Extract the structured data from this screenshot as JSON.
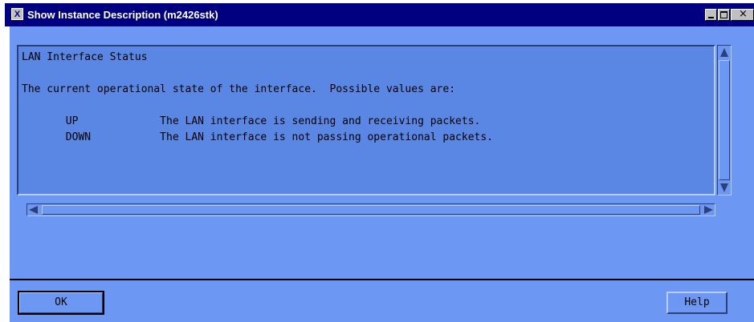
{
  "window": {
    "title": "Show Instance Description (m2426stk)",
    "icon_letter": "X",
    "controls": [
      "minimize-icon",
      "maximize-icon",
      "close-icon"
    ],
    "close_glyph": "×"
  },
  "description": {
    "lines": [
      "LAN Interface Status",
      "",
      "The current operational state of the interface.  Possible values are:",
      "",
      "       UP             The LAN interface is sending and receiving packets.",
      "       DOWN           The LAN interface is not passing operational packets."
    ]
  },
  "buttons": {
    "ok_label": "OK",
    "help_label": "Help"
  },
  "colors": {
    "titlebar": "#000080",
    "background": "#6c98f3",
    "text_area": "#5b87e4"
  }
}
